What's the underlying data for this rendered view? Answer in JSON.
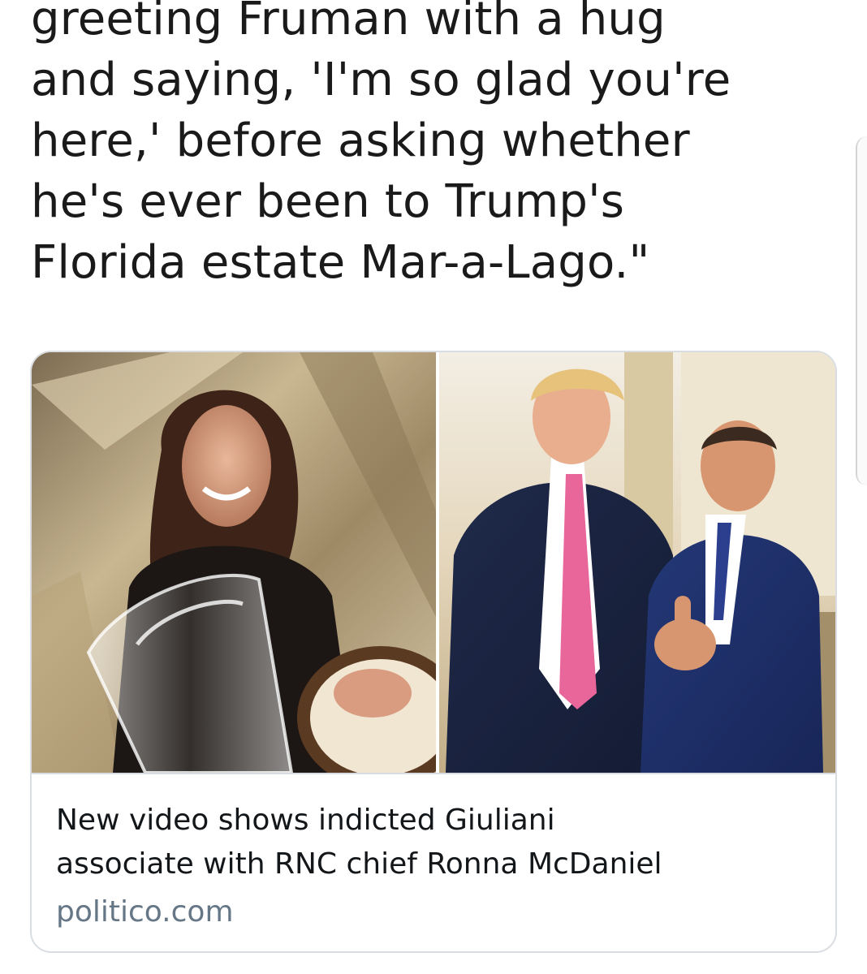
{
  "tweet": {
    "text_lines": [
      "greeting Fruman with a hug",
      "and saying, 'I'm so glad you're",
      "here,' before asking whether",
      "he's ever been to Trump's",
      "Florida estate Mar-a-Lago.\""
    ]
  },
  "link_card": {
    "title_lines": [
      "New video shows indicted Giuliani",
      "associate with RNC chief Ronna McDaniel"
    ],
    "domain": "politico.com"
  }
}
